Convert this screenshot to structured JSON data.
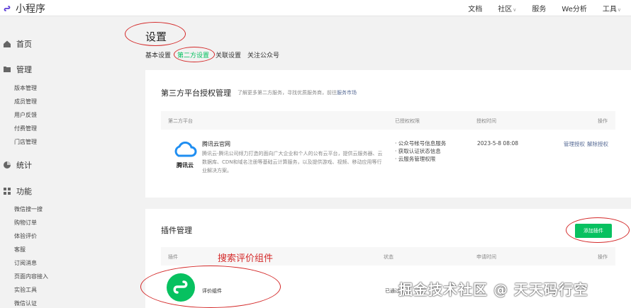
{
  "app": {
    "title": "小程序",
    "brand_color": "#07c160"
  },
  "topnav": [
    {
      "label": "文档",
      "has_caret": false
    },
    {
      "label": "社区",
      "has_caret": true
    },
    {
      "label": "服务",
      "has_caret": false
    },
    {
      "label": "We分析",
      "has_caret": false
    },
    {
      "label": "工具",
      "has_caret": true
    }
  ],
  "sidebar": {
    "home": "首页",
    "manage": "管理",
    "manage_items": [
      "版本管理",
      "成员管理",
      "用户反馈",
      "付费管理",
      "门店管理"
    ],
    "stats": "统计",
    "features": "功能",
    "feature_items": [
      "微信搜一搜",
      "购物订单",
      "体验评价",
      "客服",
      "订阅消息",
      "页面内容接入",
      "实验工具",
      "微信认证"
    ]
  },
  "page": {
    "title": "设置",
    "tabs": [
      "基本设置",
      "第二方设置",
      "关联设置",
      "关注公众号"
    ],
    "active_tab": "第二方设置"
  },
  "third_party": {
    "title": "第三方平台授权管理",
    "note_prefix": "了解更多第二方服务，寻找优质服务商，前往",
    "note_link": "服务市场",
    "headers": [
      "第二方平台",
      "已授权权限",
      "授权时间",
      "操作"
    ],
    "row": {
      "logo_label": "腾讯云",
      "name": "腾讯云官网",
      "desc": "腾讯云-腾讯公司倾力打造的面向广大企业和个人的公有云平台，提供云服务器、云数据库、CDN和域名注册等基础云计算服务，以及提供游戏、视频、移动应用等行业解决方案。",
      "permissions": [
        "· 公众号帐号信息服务",
        "· 获取认证状态信息",
        "· 云服务管理权限"
      ],
      "time": "2023-5-8 08:08",
      "actions": [
        "管理授权",
        "解除授权"
      ]
    }
  },
  "plugins": {
    "title": "插件管理",
    "add_button": "添加插件",
    "annotation": "搜索评价组件",
    "headers": [
      "插件",
      "状态",
      "申请时间",
      "操作"
    ],
    "row": {
      "name": "评价组件",
      "status": "已通过"
    }
  },
  "watermark": "掘金技术社区 @ 天天码行空"
}
